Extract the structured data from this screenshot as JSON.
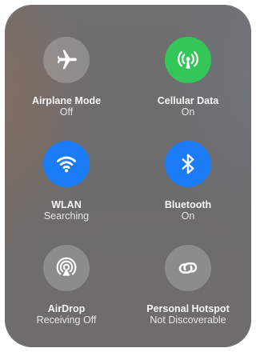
{
  "controls": [
    {
      "title": "Airplane Mode",
      "status": "Off",
      "icon": "airplane-icon",
      "state": "off"
    },
    {
      "title": "Cellular Data",
      "status": "On",
      "icon": "antenna-icon",
      "state": "on",
      "color": "#34c659"
    },
    {
      "title": "WLAN",
      "status": "Searching",
      "icon": "wifi-icon",
      "state": "on",
      "color": "#1a7cf6"
    },
    {
      "title": "Bluetooth",
      "status": "On",
      "icon": "bluetooth-icon",
      "state": "on",
      "color": "#1a7cf6"
    },
    {
      "title": "AirDrop",
      "status": "Receiving Off",
      "icon": "airdrop-icon",
      "state": "off"
    },
    {
      "title": "Personal Hotspot",
      "status": "Not Discoverable",
      "icon": "hotspot-icon",
      "state": "off"
    }
  ]
}
